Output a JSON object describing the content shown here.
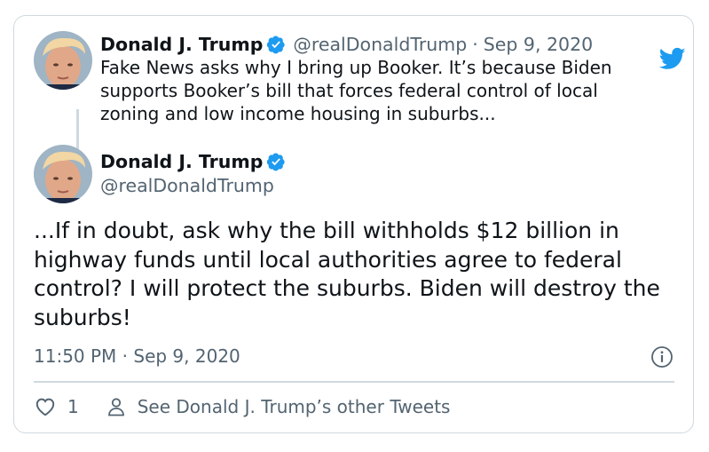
{
  "colors": {
    "accent": "#1d9bf0",
    "text": "#0f1419",
    "muted": "#536471",
    "border": "#cfd9de"
  },
  "icons": [
    "twitter-bird-icon",
    "verified-badge-icon",
    "info-icon",
    "heart-icon",
    "person-icon"
  ],
  "parent_tweet": {
    "author_name": "Donald J. Trump",
    "handle": "@realDonaldTrump",
    "separator": "·",
    "date": "Sep 9, 2020",
    "text": "Fake News asks why I bring up Booker. It’s because Biden supports Booker’s bill that forces federal control of local zoning and low income housing in suburbs..."
  },
  "main_tweet": {
    "author_name": "Donald J. Trump",
    "handle": "@realDonaldTrump",
    "text": "...If in doubt, ask why the bill withholds $12 billion in highway funds until local authorities agree to federal control? I will protect the suburbs. Biden will destroy the suburbs!",
    "timestamp": "11:50 PM · Sep 9, 2020",
    "like_count": "1",
    "other_tweets_label": "See Donald J. Trump’s other Tweets"
  }
}
